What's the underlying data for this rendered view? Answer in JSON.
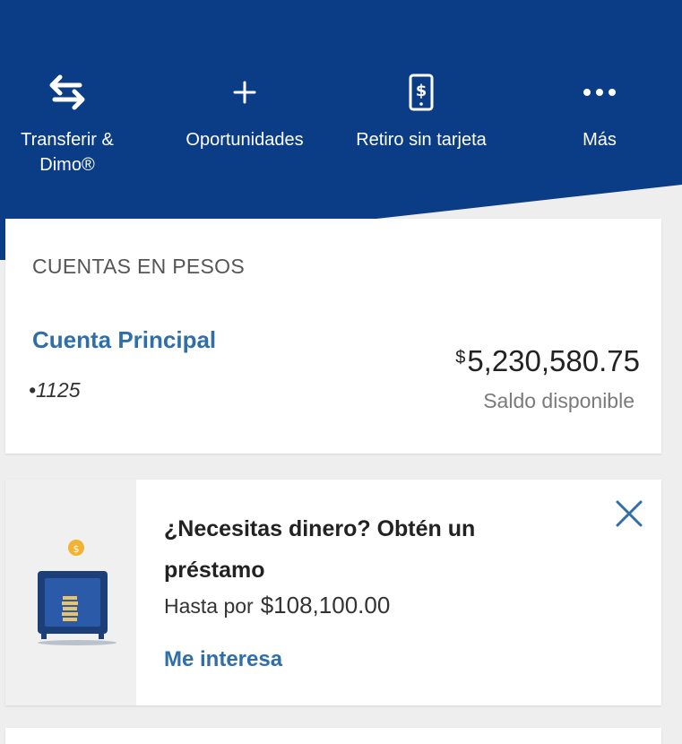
{
  "colors": {
    "header_blue": "#0b3d87",
    "link_blue": "#2f6ea8",
    "background": "#eeeeee"
  },
  "quick_actions": [
    {
      "label": "Transferir &",
      "label_line2": "Dimo®",
      "icon": "transfer-arrows-icon"
    },
    {
      "label": "Oportunidades",
      "icon": "plus-icon"
    },
    {
      "label": "Retiro sin tarjeta",
      "icon": "phone-dollar-icon"
    },
    {
      "label": "Más",
      "icon": "more-dots-icon"
    }
  ],
  "accounts": {
    "section_title": "CUENTAS EN PESOS",
    "items": [
      {
        "name": "Cuenta Principal",
        "number": "•1125",
        "currency_symbol": "$",
        "balance": "5,230,580.75",
        "balance_label": "Saldo disponible"
      }
    ]
  },
  "loan_offer": {
    "title": "¿Necesitas dinero? Obtén un préstamo",
    "amount_prefix": "Hasta por",
    "amount": "$108,100.00",
    "cta": "Me interesa",
    "illustration": "safe-coin-icon",
    "close_icon": "close-icon"
  }
}
